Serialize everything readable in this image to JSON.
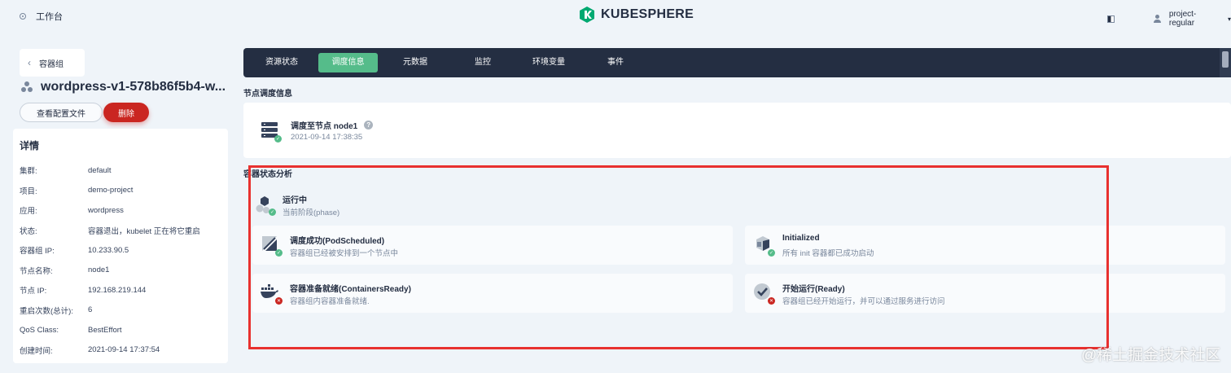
{
  "topbar": {
    "workbench_label": "工作台",
    "brand": "KUBESPHERE",
    "user": "project-regular",
    "brand_color": "#00a971"
  },
  "left": {
    "back_label": "容器组",
    "pod_name": "wordpress-v1-578b86f5b4-w...",
    "yaml_button": "查看配置文件",
    "delete_button": "删除",
    "details_title": "详情",
    "details": [
      {
        "key": "集群:",
        "value": "default"
      },
      {
        "key": "项目:",
        "value": "demo-project"
      },
      {
        "key": "应用:",
        "value": "wordpress"
      },
      {
        "key": "状态:",
        "value": "容器退出，kubelet 正在将它重启"
      },
      {
        "key": "容器组 IP:",
        "value": "10.233.90.5"
      },
      {
        "key": "节点名称:",
        "value": "node1"
      },
      {
        "key": "节点 IP:",
        "value": "192.168.219.144"
      },
      {
        "key": "重启次数(总计):",
        "value": "6"
      },
      {
        "key": "QoS Class:",
        "value": "BestEffort"
      },
      {
        "key": "创建时间:",
        "value": "2021-09-14 17:37:54"
      }
    ]
  },
  "tabs": [
    "资源状态",
    "调度信息",
    "元数据",
    "监控",
    "环境变量",
    "事件"
  ],
  "active_tab": "调度信息",
  "scheduling": {
    "section_title": "节点调度信息",
    "title": "调度至节点 node1",
    "time": "2021-09-14 17:38:35"
  },
  "analysis": {
    "section_title": "容器状态分析",
    "phase_title": "运行中",
    "phase_sub": "当前阶段(phase)",
    "conditions": [
      {
        "title": "调度成功(PodScheduled)",
        "sub": "容器组已经被安排到一个节点中",
        "status": "ok",
        "icon": "pod-scheduled-icon"
      },
      {
        "title": "Initialized",
        "sub": "所有 init 容器都已成功启动",
        "status": "ok",
        "icon": "initialized-icon"
      },
      {
        "title": "容器准备就绪(ContainersReady)",
        "sub": "容器组内容器准备就绪.",
        "status": "error",
        "icon": "docker-icon"
      },
      {
        "title": "开始运行(Ready)",
        "sub": "容器组已经开始运行，并可以通过服务进行访问",
        "status": "error",
        "icon": "ready-check-icon"
      }
    ]
  },
  "watermark": "@稀土掘金技术社区",
  "colors": {
    "ok": "#55bc8a",
    "error": "#ca2621",
    "highlight": "#e8312f",
    "tabbar": "#242e42"
  }
}
